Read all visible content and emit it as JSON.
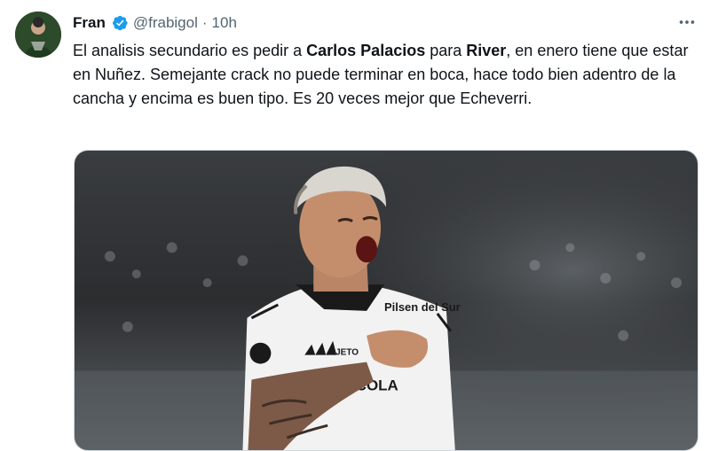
{
  "author": {
    "name": "Fran",
    "handle": "@frabigol",
    "separator": "·",
    "time": "10h"
  },
  "tweet": {
    "segments": [
      {
        "text": "El analisis secundario es pedir a ",
        "bold": false
      },
      {
        "text": "Carlos Palacios",
        "bold": true
      },
      {
        "text": " para ",
        "bold": false
      },
      {
        "text": "River",
        "bold": true
      },
      {
        "text": ", en enero tiene que estar en Nuñez. Semejante crack no puede terminar en boca, hace todo bien adentro de la cancha y encima es buen tipo. Es 20 veces mejor que Echeverri.",
        "bold": false
      }
    ]
  },
  "media": {
    "jersey_sponsor": "Pilsen del Sur",
    "jersey_brand": "JETO",
    "jersey_front": "COCA-COLA"
  },
  "icons": {
    "verified": "verified-badge-icon",
    "more": "more-options-icon"
  },
  "colors": {
    "text": "#0f1419",
    "secondary": "#536471",
    "verified": "#1d9bf0",
    "border": "#cfd9de"
  }
}
